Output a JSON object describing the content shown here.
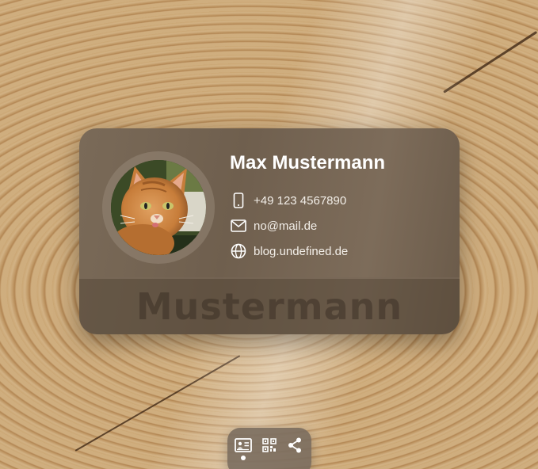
{
  "card": {
    "name": "Max Mustermann",
    "watermark": "Mustermann",
    "avatar_icon": "cat-photo",
    "contacts": [
      {
        "icon": "phone-icon",
        "text": "+49 123 4567890"
      },
      {
        "icon": "mail-icon",
        "text": "no@mail.de"
      },
      {
        "icon": "globe-icon",
        "text": "blog.undefined.de"
      }
    ]
  },
  "toolbar": {
    "buttons": [
      {
        "icon": "contact-card-icon",
        "active": true
      },
      {
        "icon": "qr-code-icon",
        "active": false
      },
      {
        "icon": "share-icon",
        "active": false
      }
    ]
  },
  "colors": {
    "card_bg": "#75654f",
    "text": "#ffffff",
    "toolbar_bg": "#786a5c"
  }
}
